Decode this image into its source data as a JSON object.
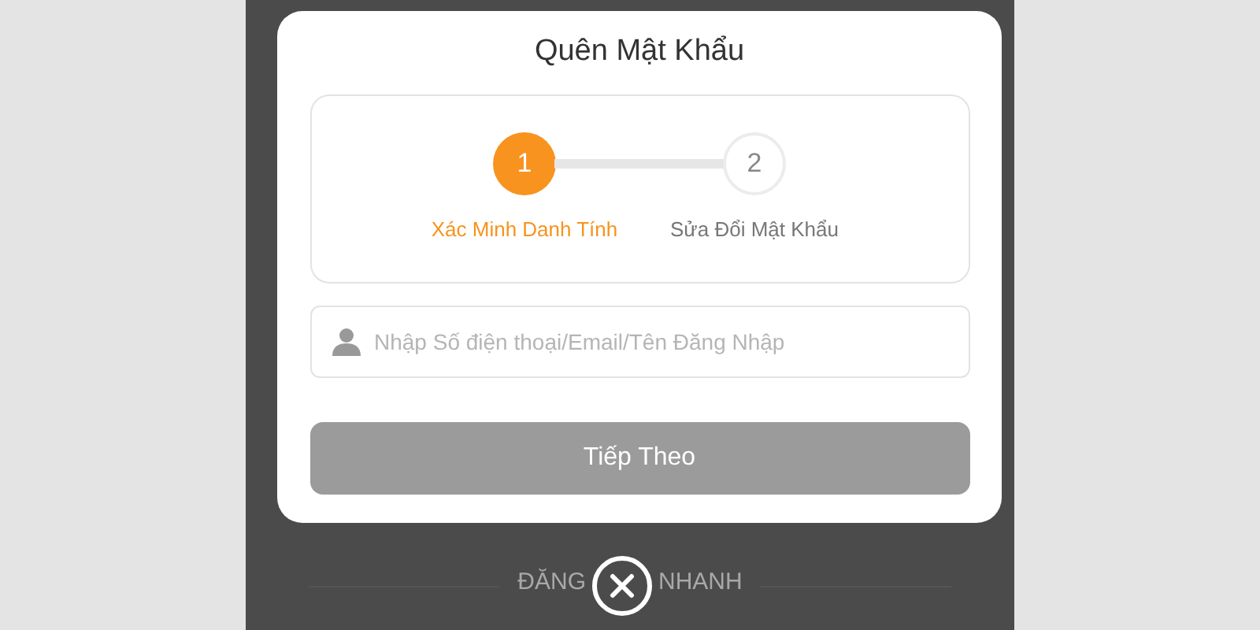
{
  "background": {
    "quick_login": [
      {
        "text": "ĐĂNG"
      },
      {
        "text": "NHANH"
      }
    ]
  },
  "dialog": {
    "title": "Quên Mật Khẩu",
    "steps": [
      {
        "number": "1",
        "label": "Xác Minh Danh Tính",
        "selected": true
      },
      {
        "number": "2",
        "label": "Sửa Đổi Mật Khẩu",
        "selected": false
      }
    ],
    "field": {
      "placeholder": "Nhập Số điện thoại/Email/Tên Đăng Nhập"
    },
    "button": {
      "label": "Tiếp Theo",
      "disabled": true
    }
  }
}
